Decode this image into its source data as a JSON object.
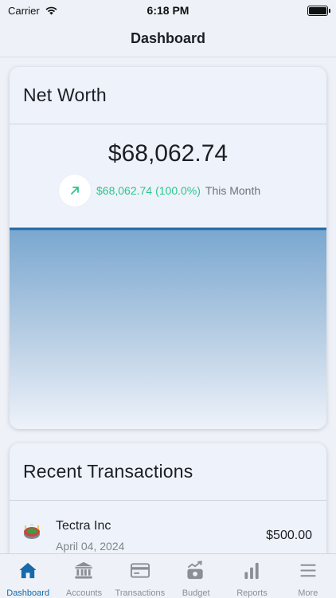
{
  "status_bar": {
    "carrier": "Carrier",
    "time": "6:18 PM"
  },
  "header": {
    "title": "Dashboard"
  },
  "net_worth": {
    "title": "Net Worth",
    "amount": "$68,062.74",
    "change_amount": "$68,062.74",
    "change_percent": "(100.0%)",
    "change_period": "This Month",
    "change_color": "#2cc58f",
    "chart_line_color": "#1e6aa6"
  },
  "recent_transactions": {
    "title": "Recent Transactions",
    "items": [
      {
        "name": "Tectra Inc",
        "date": "April 04, 2024",
        "amount": "$500.00",
        "icon": "stadium-icon"
      }
    ]
  },
  "tab_bar": {
    "active_color": "#1769aa",
    "inactive_color": "#8a8f96",
    "tabs": [
      {
        "label": "Dashboard",
        "icon": "house-icon",
        "active": true
      },
      {
        "label": "Accounts",
        "icon": "bank-icon",
        "active": false
      },
      {
        "label": "Transactions",
        "icon": "card-icon",
        "active": false
      },
      {
        "label": "Budget",
        "icon": "budget-icon",
        "active": false
      },
      {
        "label": "Reports",
        "icon": "bar-chart-icon",
        "active": false
      },
      {
        "label": "More",
        "icon": "menu-icon",
        "active": false
      }
    ]
  }
}
